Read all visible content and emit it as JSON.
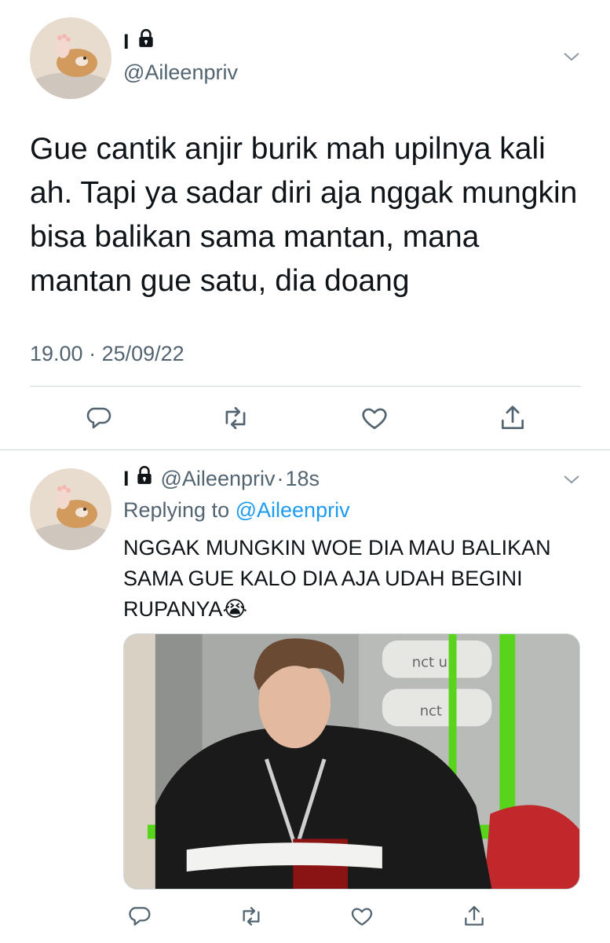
{
  "main_tweet": {
    "display_name": "I",
    "handle": "@Aileenpriv",
    "text": "Gue cantik anjir burik mah upilnya kali ah. Tapi ya sadar diri aja nggak mungkin bisa balikan sama mantan, mana mantan gue satu, dia doang",
    "time": "19.00",
    "date": "25/09/22",
    "actions": [
      "reply-icon",
      "retweet-icon",
      "like-icon",
      "share-icon"
    ]
  },
  "reply_tweet": {
    "display_name": "I",
    "handle": "@Aileenpriv",
    "dot": "·",
    "age": "18s",
    "replying_prefix": "Replying to",
    "replying_handle": "@Aileenpriv",
    "text": "NGGAK MUNGKIN WOE DIA MAU BALIKAN SAMA GUE KALO DIA AJA UDAH BEGINI RUPANYA",
    "emoji": "😭",
    "media_sign_1": "nct u",
    "media_sign_2": "nct",
    "actions": [
      "reply-icon",
      "retweet-icon",
      "like-icon",
      "share-icon"
    ]
  },
  "colors": {
    "text": "#0f1419",
    "secondary": "#536471",
    "link": "#1d9bf0",
    "divider": "#cfd9de",
    "icon": "#536471"
  }
}
